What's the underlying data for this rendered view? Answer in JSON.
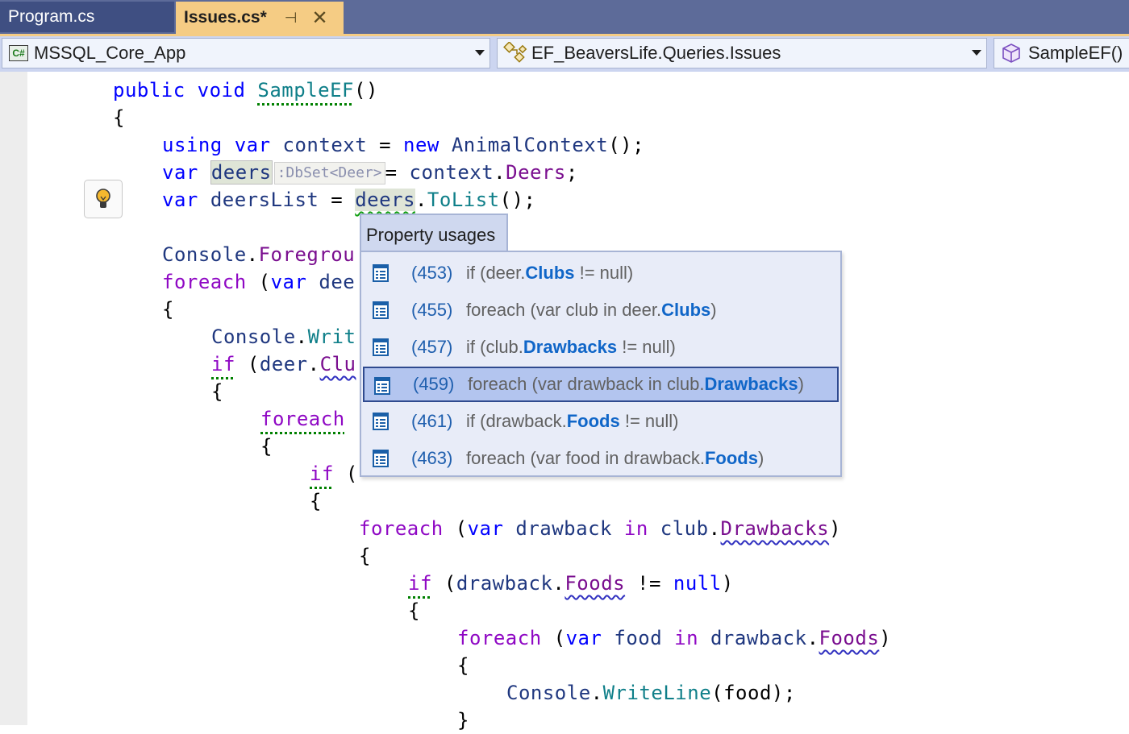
{
  "tabs": [
    {
      "label": "Program.cs",
      "active": false
    },
    {
      "label": "Issues.cs*",
      "active": true,
      "pin_icon": "⊣",
      "close_icon": "✕"
    }
  ],
  "navbar": {
    "project": {
      "icon": "csharp-project-icon",
      "icon_text": "C#",
      "label": "MSSQL_Core_App"
    },
    "type": {
      "icon": "class-icon",
      "label": "EF_BeaversLife.Queries.Issues"
    },
    "member": {
      "icon": "method-cube-icon",
      "label": "SampleEF()"
    }
  },
  "code": {
    "l1": {
      "kw1": "public",
      "kw2": "void",
      "name": "SampleEF",
      "rest": "()"
    },
    "l2": "{",
    "l3": {
      "kw1": "using",
      "kw2": "var",
      "id": "context",
      "eq": " = ",
      "kw3": "new",
      "type": "AnimalContext",
      "rest": "();"
    },
    "l4": {
      "kw": "var",
      "id": "deers",
      "hint": ":DbSet<Deer>",
      "eq": "= ",
      "obj": "context",
      "dot": ".",
      "prop": "Deers",
      "end": ";"
    },
    "l5": {
      "kw": "var",
      "id": "deersList",
      "eq": " = ",
      "obj": "deers",
      "dot": ".",
      "method": "ToList",
      "end": "();"
    },
    "l6": {
      "obj": "Console",
      "dot": ".",
      "prop": "Foregrou"
    },
    "l7": {
      "kw": "foreach",
      "open": " (",
      "kw2": "var",
      "id": " dee"
    },
    "l8": "{",
    "l9": {
      "obj": "Console",
      "dot": ".",
      "method": "Writ"
    },
    "l10": {
      "kw": "if",
      "open": " (",
      "obj": "deer",
      "dot": ".",
      "prop": "Clu"
    },
    "l11": "{",
    "l12": {
      "kw": "foreach"
    },
    "l13": "{",
    "l14": {
      "kw": "if",
      "open": " ("
    },
    "l15": "{",
    "l16": {
      "kw": "foreach",
      "open": " (",
      "kw2": "var",
      "id": " drawback ",
      "kw3": "in",
      "obj": " club",
      "dot": ".",
      "prop": "Drawbacks",
      "end": ")"
    },
    "l17": "{",
    "l18": {
      "kw": "if",
      "open": " (",
      "obj": "drawback",
      "dot": ".",
      "prop": "Foods",
      "op": " != ",
      "kw2": "null",
      "end": ")"
    },
    "l19": "{",
    "l20": {
      "kw": "foreach",
      "open": " (",
      "kw2": "var",
      "id": " food ",
      "kw3": "in",
      "obj": " drawback",
      "dot": ".",
      "prop": "Foods",
      "end": ")"
    },
    "l21": "{",
    "l22": {
      "obj": "Console",
      "dot": ".",
      "method": "WriteLine",
      "args": "(food);"
    },
    "l23": "}"
  },
  "popup": {
    "title": "Property usages",
    "items": [
      {
        "line": "(453)",
        "pre": "if (deer.",
        "bold": "Clubs",
        "post": " != null)",
        "selected": false
      },
      {
        "line": "(455)",
        "pre": "foreach (var club in deer.",
        "bold": "Clubs",
        "post": ")",
        "selected": false
      },
      {
        "line": "(457)",
        "pre": "if (club.",
        "bold": "Drawbacks",
        "post": " != null)",
        "selected": false
      },
      {
        "line": "(459)",
        "pre": "foreach (var drawback in club.",
        "bold": "Drawbacks",
        "post": ")",
        "selected": true
      },
      {
        "line": "(461)",
        "pre": "if (drawback.",
        "bold": "Foods",
        "post": " != null)",
        "selected": false
      },
      {
        "line": "(463)",
        "pre": "foreach (var food in drawback.",
        "bold": "Foods",
        "post": ")",
        "selected": false
      }
    ]
  },
  "lightbulb": {
    "icon": "lightbulb-icon"
  },
  "colors": {
    "tab_active": "#f5cc84",
    "tab_strip": "#5d6b99",
    "selection": "#b3c5ef",
    "keyword": "#0000ff",
    "control_keyword": "#8f08c4"
  }
}
